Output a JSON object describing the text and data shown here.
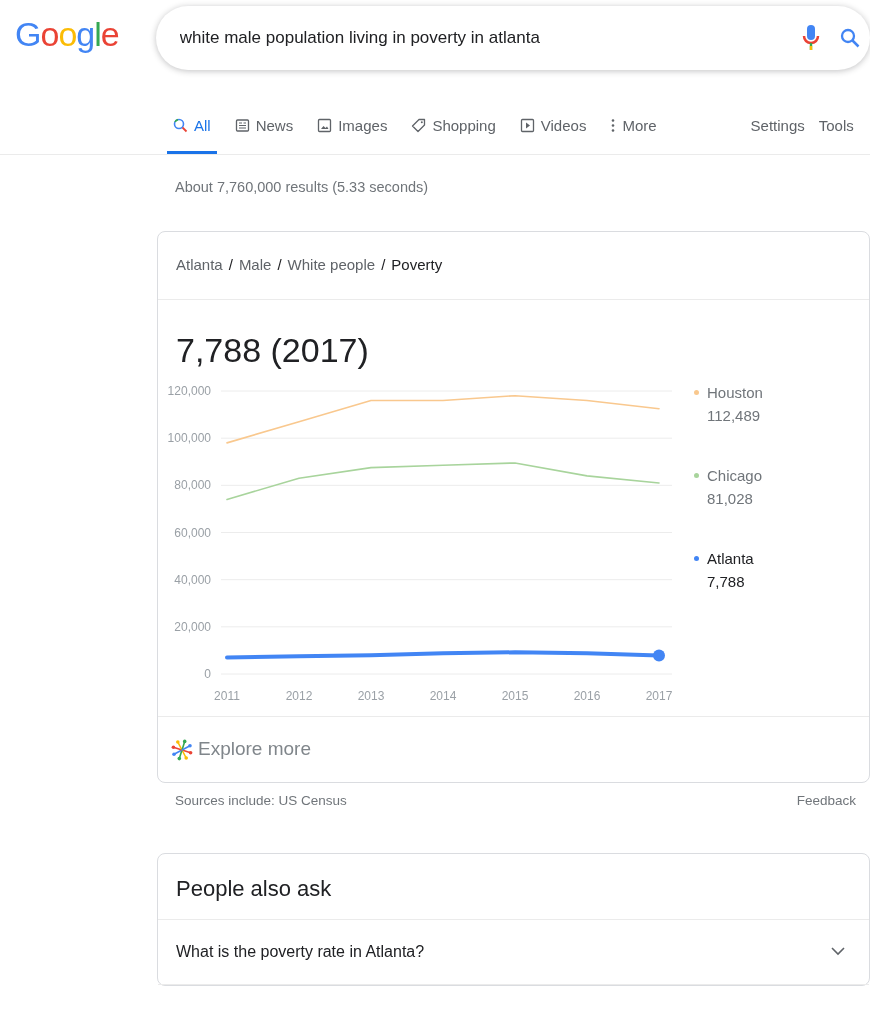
{
  "logo": "Google",
  "search": {
    "value": "white male population living in poverty in atlanta"
  },
  "tabs": [
    {
      "label": "All",
      "selected": true
    },
    {
      "label": "News",
      "selected": false
    },
    {
      "label": "Images",
      "selected": false
    },
    {
      "label": "Shopping",
      "selected": false
    },
    {
      "label": "Videos",
      "selected": false
    },
    {
      "label": "More",
      "selected": false
    }
  ],
  "tools": [
    "Settings",
    "Tools"
  ],
  "result_stats": "About 7,760,000 results (5.33 seconds)",
  "card": {
    "breadcrumb": [
      "Atlanta",
      "Male",
      "White people",
      "Poverty"
    ],
    "breadcrumb_separator": "/",
    "headline": "7,788 (2017)",
    "chart_data": {
      "type": "line",
      "categories": [
        "2011",
        "2012",
        "2013",
        "2014",
        "2015",
        "2016",
        "2017"
      ],
      "ylim": [
        0,
        120000
      ],
      "grid": true,
      "yticks": [
        {
          "value": 0,
          "label": "0"
        },
        {
          "value": 20000,
          "label": "20,000"
        },
        {
          "value": 40000,
          "label": "40,000"
        },
        {
          "value": 60000,
          "label": "60,000"
        },
        {
          "value": 80000,
          "label": "80,000"
        },
        {
          "value": 100000,
          "label": "100,000"
        },
        {
          "value": 120000,
          "label": "120,000"
        }
      ],
      "series": [
        {
          "name": "Houston",
          "color": "#f9c88e",
          "values": [
            98000,
            107000,
            116000,
            116000,
            118000,
            116000,
            112500
          ]
        },
        {
          "name": "Chicago",
          "color": "#a8d49c",
          "values": [
            74000,
            83000,
            87500,
            88500,
            89500,
            84000,
            81000
          ]
        },
        {
          "name": "Atlanta",
          "color": "#4285f4",
          "values": [
            7000,
            7500,
            8000,
            8800,
            9200,
            8800,
            7800
          ]
        }
      ]
    },
    "legend": [
      {
        "value": "112,489",
        "selected": false
      },
      {
        "value": "81,028",
        "selected": false
      },
      {
        "value": "7,788",
        "selected": true
      }
    ],
    "explore": "Explore more"
  },
  "sources": "Sources include: US Census",
  "feedback": "Feedback",
  "people_also_ask": {
    "title": "People also ask",
    "questions": [
      {
        "text": "What is the poverty rate in Atlanta?",
        "expanded": false
      }
    ]
  }
}
